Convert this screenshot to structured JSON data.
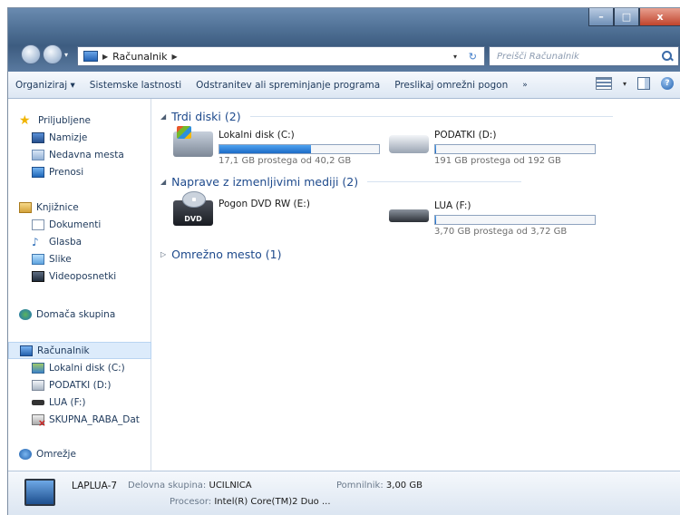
{
  "window": {
    "buttons": {
      "minimize": "–",
      "maximize": "□",
      "close": "x"
    }
  },
  "address": {
    "path": "Računalnik",
    "search_placeholder": "Preišči Računalnik"
  },
  "commandbar": {
    "organize": "Organiziraj ▾",
    "system_properties": "Sistemske lastnosti",
    "uninstall": "Odstranitev ali spreminjanje programa",
    "map_drive": "Preslikaj omrežni pogon",
    "more": "»"
  },
  "sidebar": {
    "favorites": {
      "header": "Priljubljene",
      "items": [
        "Namizje",
        "Nedavna mesta",
        "Prenosi"
      ]
    },
    "libraries": {
      "header": "Knjižnice",
      "items": [
        "Dokumenti",
        "Glasba",
        "Slike",
        "Videoposnetki"
      ]
    },
    "homegroup": "Domača skupina",
    "computer": {
      "header": "Računalnik",
      "items": [
        "Lokalni disk (C:)",
        "PODATKI (D:)",
        "LUA (F:)",
        "SKUPNA_RABA_Dat"
      ]
    },
    "network": "Omrežje"
  },
  "content": {
    "groups": [
      {
        "title": "Trdi diski (2)"
      },
      {
        "title": "Naprave z izmenljivimi mediji (2)"
      },
      {
        "title": "Omrežno mesto (1)"
      }
    ],
    "drives": [
      {
        "name": "Lokalni disk (C:)",
        "free": "17,1 GB prostega od 40,2 GB",
        "used_fraction": 0.575
      },
      {
        "name": "PODATKI (D:)",
        "free": "191 GB prostega od 192 GB",
        "used_fraction": 0.005
      },
      {
        "name": "Pogon DVD RW (E:)",
        "badge": "DVD"
      },
      {
        "name": "LUA (F:)",
        "free": "3,70 GB prostega od 3,72 GB",
        "used_fraction": 0.005
      }
    ]
  },
  "details": {
    "name": "LAPLUA-7",
    "workgroup_label": "Delovna skupina:",
    "workgroup": "UCILNICA",
    "memory_label": "Pomnilnik:",
    "memory": "3,00 GB",
    "processor_label": "Procesor:",
    "processor": "Intel(R) Core(TM)2 Duo ..."
  },
  "colors": {
    "titlebar": "#4e6f94",
    "accent_bar": "#1c6ac6",
    "link": "#1e4a8c"
  }
}
